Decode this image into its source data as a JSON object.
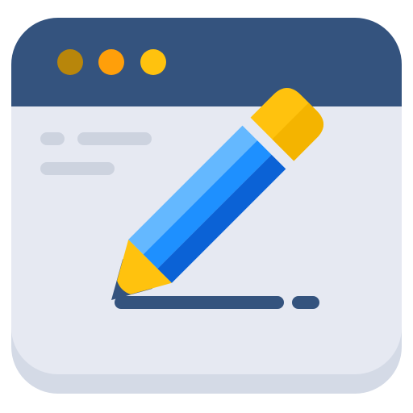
{
  "icon": {
    "name": "edit-document-app-icon",
    "window_dots": [
      {
        "name": "window-dot-left",
        "color": "#b8860b"
      },
      {
        "name": "window-dot-middle",
        "color": "#ff9f0a"
      },
      {
        "name": "window-dot-right",
        "color": "#ffc20e"
      }
    ],
    "colors": {
      "titlebar": "#34537e",
      "window_body": "#e6e9f2",
      "window_shadow": "#d4dae6",
      "text_placeholder": "#cdd3df",
      "pencil_light_blue": "#64b8ff",
      "pencil_mid_blue": "#1e90ff",
      "pencil_dark_blue": "#0b62d6",
      "pencil_wood": "#ffc20e",
      "pencil_eraser": "#ffc20e",
      "pencil_ferrule": "#e6e9f2",
      "ink_line": "#34537e"
    }
  }
}
